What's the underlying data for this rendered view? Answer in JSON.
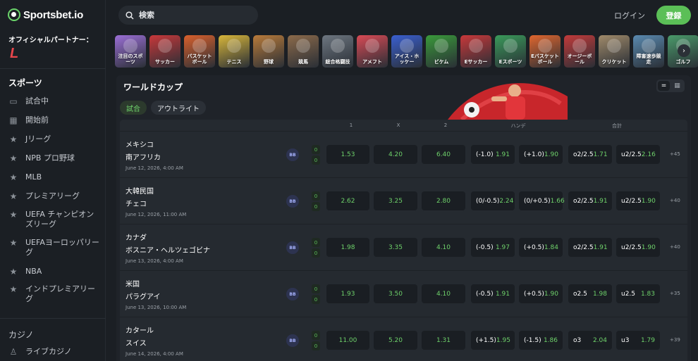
{
  "brand": {
    "name": "Sportsbet.io",
    "partner_label": "オフィシャルパートナー：",
    "partner_logo_text": "L"
  },
  "search": {
    "placeholder": "検索"
  },
  "header": {
    "login": "ログイン",
    "register": "登録"
  },
  "sidebar": {
    "sports_title": "スポーツ",
    "items": [
      {
        "label": "試合中",
        "icon": "monitor-icon"
      },
      {
        "label": "開始前",
        "icon": "calendar-icon"
      },
      {
        "label": "Jリーグ",
        "icon": "star-icon"
      },
      {
        "label": "NPB プロ野球",
        "icon": "star-icon"
      },
      {
        "label": "MLB",
        "icon": "star-icon"
      },
      {
        "label": "プレミアリーグ",
        "icon": "star-icon"
      },
      {
        "label": "UEFA チャンピオンズリーグ",
        "icon": "star-icon"
      },
      {
        "label": "UEFAヨーロッパリーグ",
        "icon": "star-icon"
      },
      {
        "label": "NBA",
        "icon": "star-icon"
      },
      {
        "label": "インドプレミアリーグ",
        "icon": "star-icon"
      }
    ],
    "casino_title": "カジノ",
    "casino_items": [
      {
        "label": "ライブカジノ",
        "icon": "dealer-icon"
      }
    ]
  },
  "carousel": {
    "tiles": [
      {
        "label": "注目のスポーツ",
        "color": "#9b6fd6"
      },
      {
        "label": "サッカー",
        "color": "#c8383a"
      },
      {
        "label": "バスケットボール",
        "color": "#d9602c"
      },
      {
        "label": "テニス",
        "color": "#d8b63a"
      },
      {
        "label": "野球",
        "color": "#b97b3a"
      },
      {
        "label": "競馬",
        "color": "#8c6a4a"
      },
      {
        "label": "総合格闘技",
        "color": "#6d7680"
      },
      {
        "label": "アメフト",
        "color": "#d94a55"
      },
      {
        "label": "アイス・ホッケー",
        "color": "#3a5fd0"
      },
      {
        "label": "ビケム",
        "color": "#3a9a3a"
      },
      {
        "label": "Eサッカー",
        "color": "#c8383a"
      },
      {
        "label": "Eスポーツ",
        "color": "#3a9a5a"
      },
      {
        "label": "Eバスケットボール",
        "color": "#e0662e"
      },
      {
        "label": "オージーボール",
        "color": "#c23a3a"
      },
      {
        "label": "クリケット",
        "color": "#a08a6a"
      },
      {
        "label": "障害速歩競走",
        "color": "#5a8ab0"
      },
      {
        "label": "ゴルフ",
        "color": "#4a9a6a"
      }
    ],
    "next_icon": "›"
  },
  "panel": {
    "title": "ワールドカップ",
    "tabs": [
      {
        "label": "試合"
      },
      {
        "label": "アウトライト"
      }
    ],
    "columns": {
      "c1": "1",
      "cx": "X",
      "c2": "2",
      "handicap": "ハンデ",
      "total": "合計"
    },
    "bb_label": "BB"
  },
  "matches": [
    {
      "home": "メキシコ",
      "away": "南アフリカ",
      "date": "June 12, 2026, 4:00 AM",
      "score_home": "0",
      "score_away": "0",
      "odds_1": "1.53",
      "odds_x": "4.20",
      "odds_2": "6.40",
      "hcp1_label": "(-1.0)",
      "hcp1_odds": "1.91",
      "hcp2_label": "(+1.0)",
      "hcp2_odds": "1.90",
      "over_label": "o2/2.5",
      "over_odds": "1.71",
      "under_label": "u2/2.5",
      "under_odds": "2.16",
      "more": "+45"
    },
    {
      "home": "大韓民国",
      "away": "チェコ",
      "date": "June 12, 2026, 11:00 AM",
      "score_home": "0",
      "score_away": "0",
      "odds_1": "2.62",
      "odds_x": "3.25",
      "odds_2": "2.80",
      "hcp1_label": "(0/-0.5)",
      "hcp1_odds": "2.24",
      "hcp2_label": "(0/+0.5)",
      "hcp2_odds": "1.66",
      "over_label": "o2/2.5",
      "over_odds": "1.91",
      "under_label": "u2/2.5",
      "under_odds": "1.90",
      "more": "+40"
    },
    {
      "home": "カナダ",
      "away": "ボスニア・ヘルツェゴビナ",
      "date": "June 13, 2026, 4:00 AM",
      "score_home": "0",
      "score_away": "0",
      "odds_1": "1.98",
      "odds_x": "3.35",
      "odds_2": "4.10",
      "hcp1_label": "(-0.5)",
      "hcp1_odds": "1.97",
      "hcp2_label": "(+0.5)",
      "hcp2_odds": "1.84",
      "over_label": "o2/2.5",
      "over_odds": "1.91",
      "under_label": "u2/2.5",
      "under_odds": "1.90",
      "more": "+40"
    },
    {
      "home": "米国",
      "away": "パラグアイ",
      "date": "June 13, 2026, 10:00 AM",
      "score_home": "0",
      "score_away": "0",
      "odds_1": "1.93",
      "odds_x": "3.50",
      "odds_2": "4.10",
      "hcp1_label": "(-0.5)",
      "hcp1_odds": "1.91",
      "hcp2_label": "(+0.5)",
      "hcp2_odds": "1.90",
      "over_label": "o2.5",
      "over_odds": "1.98",
      "under_label": "u2.5",
      "under_odds": "1.83",
      "more": "+35"
    },
    {
      "home": "カタール",
      "away": "スイス",
      "date": "June 14, 2026, 4:00 AM",
      "score_home": "0",
      "score_away": "0",
      "odds_1": "11.00",
      "odds_x": "5.20",
      "odds_2": "1.31",
      "hcp1_label": "(+1.5)",
      "hcp1_odds": "1.95",
      "hcp2_label": "(-1.5)",
      "hcp2_odds": "1.86",
      "over_label": "o3",
      "over_odds": "2.04",
      "under_label": "u3",
      "under_odds": "1.79",
      "more": "+39"
    }
  ]
}
